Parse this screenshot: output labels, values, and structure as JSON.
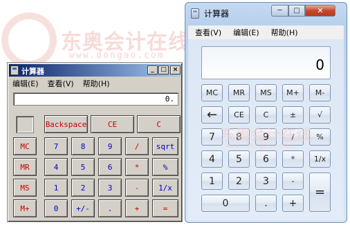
{
  "watermark": {
    "brand_text": "东奥会计在线",
    "url_text": "www.dongao.com",
    "overlay_text": "东奥会计在线",
    "overlay_url": "www.dongao.com"
  },
  "win7_calc": {
    "title": "计算器",
    "controls": {
      "minimize": "─",
      "maximize": "□",
      "close": "✕"
    },
    "menus": [
      "查看(V)",
      "编辑(E)",
      "帮助(H)"
    ],
    "display_value": "0",
    "buttons": [
      "MC",
      "MR",
      "MS",
      "M+",
      "M-",
      "←",
      "CE",
      "C",
      "±",
      "√",
      "7",
      "8",
      "9",
      "/",
      "%",
      "4",
      "5",
      "6",
      "*",
      "1/x",
      "1",
      "2",
      "3",
      "-",
      "=",
      "0",
      ".",
      "+"
    ]
  },
  "classic_calc": {
    "title": "计算器",
    "controls": {
      "minimize": "_",
      "maximize": "□",
      "close": "×"
    },
    "menus": [
      "编辑(E)",
      "查看(V)",
      "帮助(H)"
    ],
    "display_value": "0.",
    "buttons": [
      "Backspace",
      "CE",
      "C",
      "MC",
      "7",
      "8",
      "9",
      "/",
      "sqrt",
      "MR",
      "4",
      "5",
      "6",
      "*",
      "%",
      "MS",
      "1",
      "2",
      "3",
      "-",
      "1/x",
      "M+",
      "0",
      "+/-",
      ".",
      "+",
      "="
    ]
  }
}
